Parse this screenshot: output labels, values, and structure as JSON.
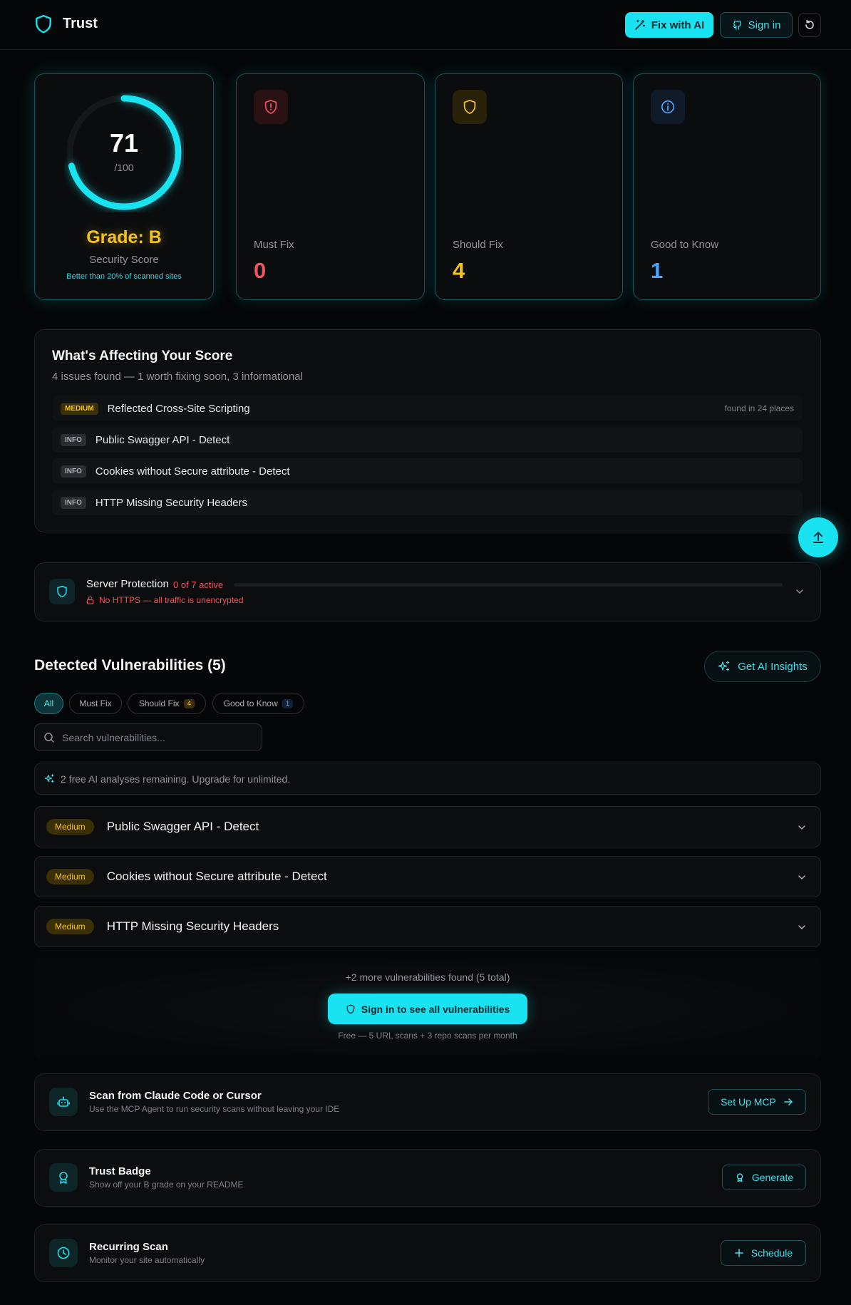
{
  "header": {
    "app_name": "Trust",
    "fix_ai_label": "Fix with AI",
    "signin_label": "Sign in"
  },
  "score": {
    "value": "71",
    "denominator": "/100",
    "fraction": 0.71,
    "grade": "Grade: B",
    "label": "Security Score",
    "comparison": "Better than 20% of scanned sites"
  },
  "stats": {
    "must_fix": {
      "label": "Must Fix",
      "value": "0"
    },
    "should_fix": {
      "label": "Should Fix",
      "value": "4"
    },
    "good_to_know": {
      "label": "Good to Know",
      "value": "1"
    }
  },
  "affecting": {
    "title": "What's Affecting Your Score",
    "subtitle": "4 issues found — 1 worth fixing soon, 3 informational",
    "issues": [
      {
        "tag": "MEDIUM",
        "text": "Reflected Cross-Site Scripting",
        "meta": "found in 24 places"
      },
      {
        "tag": "INFO",
        "text": "Public Swagger API - Detect"
      },
      {
        "tag": "INFO",
        "text": "Cookies without Secure attribute - Detect"
      },
      {
        "tag": "INFO",
        "text": "HTTP Missing Security Headers"
      }
    ]
  },
  "server": {
    "title": "Server Protection",
    "count": "0 of 7 active",
    "progress": 0,
    "warning": "No HTTPS — all traffic is unencrypted"
  },
  "vulns": {
    "title": "Detected Vulnerabilities (5)",
    "insights_label": "Get AI Insights",
    "filters": {
      "all": "All",
      "must_fix": "Must Fix",
      "should_fix": "Should Fix",
      "should_fix_count": "4",
      "good_to_know": "Good to Know",
      "good_to_know_count": "1"
    },
    "search_placeholder": "Search vulnerabilities...",
    "ai_note": "2 free AI analyses remaining. Upgrade for unlimited.",
    "items": [
      {
        "severity": "Medium",
        "title": "Public Swagger API - Detect"
      },
      {
        "severity": "Medium",
        "title": "Cookies without Secure attribute - Detect"
      },
      {
        "severity": "Medium",
        "title": "HTTP Missing Security Headers"
      }
    ],
    "more_text": "+2 more vulnerabilities found (5 total)",
    "signin_all_label": "Sign in to see all vulnerabilities",
    "free_text": "Free — 5 URL scans + 3 repo scans per month"
  },
  "features": {
    "mcp": {
      "title": "Scan from Claude Code or Cursor",
      "subtitle": "Use the MCP Agent to run security scans without leaving your IDE",
      "button": "Set Up MCP"
    },
    "badge": {
      "title": "Trust Badge",
      "subtitle": "Show off your B grade on your README",
      "button": "Generate"
    },
    "recurring": {
      "title": "Recurring Scan",
      "subtitle": "Monitor your site automatically",
      "button": "Schedule"
    }
  },
  "colors": {
    "accent": "#19e3f0",
    "grade": "#f4c21b",
    "danger": "#f0555a",
    "info": "#4aa3ff",
    "background": "#050607"
  }
}
